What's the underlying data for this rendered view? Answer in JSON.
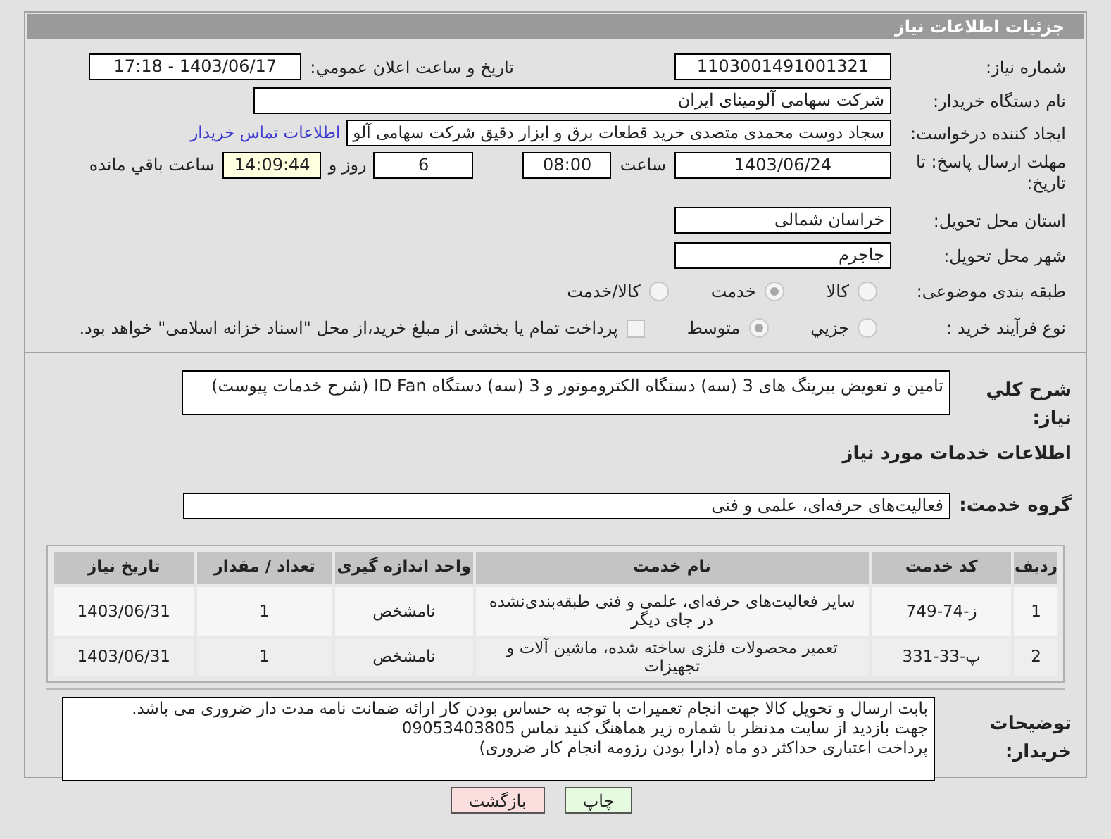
{
  "header": {
    "title": "جزئیات اطلاعات نیاز"
  },
  "need_number": {
    "label": "شماره نیاز:",
    "value": "1103001491001321"
  },
  "announce": {
    "label": "تاریخ و ساعت اعلان عمومي:",
    "value": "1403/06/17 - 17:18"
  },
  "buyer": {
    "label": "نام دستگاه خریدار:",
    "value": "شرکت سهامی آلومینای ایران"
  },
  "requester": {
    "label": "ایجاد کننده درخواست:",
    "value": "سجاد دوست محمدی متصدی خرید قطعات برق و ابزار دقیق شرکت سهامی آلو",
    "link": "اطلاعات تماس خریدار"
  },
  "deadline": {
    "label": "مهلت ارسال پاسخ: تا تاریخ:",
    "date": "1403/06/24",
    "time_label": "ساعت",
    "time": "08:00",
    "days": "6",
    "days_label": "روز و",
    "remaining": "14:09:44",
    "remaining_label": "ساعت باقي مانده"
  },
  "province": {
    "label": "استان محل تحویل:",
    "value": "خراسان شمالی"
  },
  "city": {
    "label": "شهر محل تحویل:",
    "value": "جاجرم"
  },
  "category": {
    "label": "طبقه بندی موضوعی:",
    "options": [
      {
        "label": "کالا",
        "selected": false
      },
      {
        "label": "خدمت",
        "selected": true
      },
      {
        "label": "کالا/خدمت",
        "selected": false
      }
    ]
  },
  "process": {
    "label": "نوع فرآیند خرید :",
    "options": [
      {
        "label": "جزیي",
        "selected": false
      },
      {
        "label": "متوسط",
        "selected": true
      }
    ],
    "treasury": {
      "label": "پرداخت تمام یا بخشی از مبلغ خرید،از محل \"اسناد خزانه اسلامی\" خواهد بود.",
      "checked": false
    }
  },
  "description": {
    "label": "شرح کلي نیاز:",
    "value": "تامین و تعویض بیرینگ های 3 (سه) دستگاه الکتروموتور و 3 (سه) دستگاه ID Fan (شرح خدمات پیوست)"
  },
  "services_title": "اطلاعات خدمات مورد نیاز",
  "service_group": {
    "label": "گروه خدمت:",
    "value": "فعالیت‌های حرفه‌ای، علمی و فنی"
  },
  "table": {
    "columns": [
      "ردیف",
      "کد خدمت",
      "نام خدمت",
      "واحد اندازه گیری",
      "تعداد / مقدار",
      "تاریخ نیاز"
    ],
    "rows": [
      [
        "1",
        "ز-74-749",
        "سایر فعالیت‌های حرفه‌ای، علمی و فنی طبقه‌بندی‌نشده در جای دیگر",
        "نامشخص",
        "1",
        "1403/06/31"
      ],
      [
        "2",
        "پ-33-331",
        "تعمیر محصولات فلزی ساخته شده، ماشین آلات و تجهیزات",
        "نامشخص",
        "1",
        "1403/06/31"
      ]
    ]
  },
  "buyer_notes": {
    "label": "توضیحات خریدار:",
    "lines": [
      "بابت ارسال و تحویل کالا جهت انجام تعمیرات با توجه به حساس بودن کار ارائه ضمانت نامه مدت دار ضروری می باشد.",
      "جهت بازدید از سایت مدنظر با شماره زیر هماهنگ کنید تماس 09053403805",
      "پرداخت اعتباری حداکثر دو ماه (دارا بودن رزومه انجام کار ضروری)"
    ]
  },
  "buttons": [
    {
      "label": "چاپ",
      "kind": "print"
    },
    {
      "label": "بازگشت",
      "kind": "back"
    }
  ]
}
